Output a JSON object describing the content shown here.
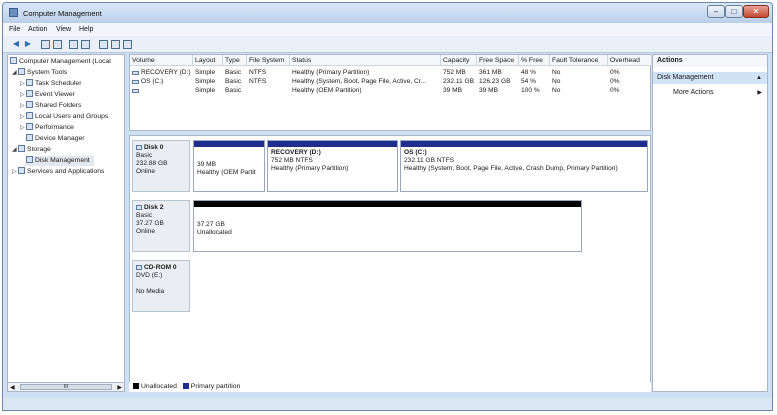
{
  "window": {
    "title": "Computer Management",
    "buttons": {
      "minimize": "–",
      "maximize": "□",
      "close": "✕"
    }
  },
  "menu": [
    "File",
    "Action",
    "View",
    "Help"
  ],
  "toolbar": {
    "back": "◀",
    "forward": "▶"
  },
  "tree": {
    "root": "Computer Management (Local",
    "system_tools": "System Tools",
    "task_scheduler": "Task Scheduler",
    "event_viewer": "Event Viewer",
    "shared_folders": "Shared Folders",
    "local_users": "Local Users and Groups",
    "performance": "Performance",
    "device_manager": "Device Manager",
    "storage": "Storage",
    "disk_management": "Disk Management",
    "services": "Services and Applications",
    "scroll_left": "◀",
    "scroll_right": "▶",
    "scroll_grip": "III"
  },
  "volumes": {
    "headers": [
      "Volume",
      "Layout",
      "Type",
      "File System",
      "Status",
      "Capacity",
      "Free Space",
      "% Free",
      "Fault Tolerance",
      "Overhead"
    ],
    "rows": [
      [
        "RECOVERY (D:)",
        "Simple",
        "Basic",
        "NTFS",
        "Healthy (Primary Partition)",
        "752 MB",
        "361 MB",
        "48 %",
        "No",
        "0%"
      ],
      [
        "OS (C:)",
        "Simple",
        "Basic",
        "NTFS",
        "Healthy (System, Boot, Page File, Active, Cr...",
        "232.11 GB",
        "126.23 GB",
        "54 %",
        "No",
        "0%"
      ],
      [
        "",
        "Simple",
        "Basic",
        "",
        "Healthy (OEM Partition)",
        "39 MB",
        "39 MB",
        "100 %",
        "No",
        "0%"
      ]
    ]
  },
  "disks": [
    {
      "name": "Disk 0",
      "type": "Basic",
      "size": "232.88 GB",
      "state": "Online",
      "partitions": [
        {
          "title": "",
          "size": "39 MB",
          "status": "Healthy (OEM Partit"
        },
        {
          "title": "RECOVERY  (D:)",
          "size": "752 MB NTFS",
          "status": "Healthy (Primary Partition)"
        },
        {
          "title": "OS  (C:)",
          "size": "232.11 GB NTFS",
          "status": "Healthy (System, Boot, Page File, Active, Crash Dump, Primary Partition)"
        }
      ]
    },
    {
      "name": "Disk 2",
      "type": "Basic",
      "size": "37.27 GB",
      "state": "Online",
      "partitions": [
        {
          "title": "",
          "size": "37.27 GB",
          "status": "Unallocated"
        }
      ]
    },
    {
      "name": "CD-ROM 0",
      "type": "DVD (E:)",
      "size": "",
      "state": "No Media",
      "partitions": []
    }
  ],
  "legend": {
    "unallocated": "Unallocated",
    "primary": "Primary partition"
  },
  "colors": {
    "unallocated": "#000000",
    "primary": "#1f2d8f",
    "selected_action": "#cfe2f6"
  },
  "actions": {
    "title": "Actions",
    "section": "Disk Management",
    "more": "More Actions",
    "section_caret": "▲",
    "more_arrow": "▶"
  }
}
